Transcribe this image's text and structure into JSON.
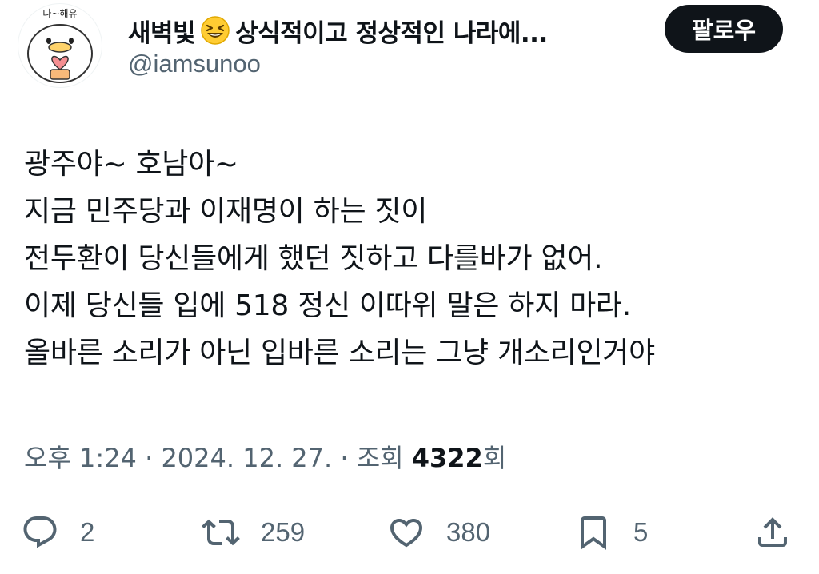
{
  "profile": {
    "display_name": "새벽빛",
    "display_name_suffix": "상식적이고 정상적인 나라에...",
    "emoji": "laughing-face-emoji",
    "handle": "@iamsunoo",
    "avatar_text": "나~해유"
  },
  "follow_button": {
    "label": "팔로우"
  },
  "tweet": {
    "lines": [
      "광주야~ 호남아~",
      "지금 민주당과 이재명이 하는 짓이",
      "전두환이 당신들에게 했던 짓하고 다를바가 없어.",
      "이제 당신들 입에 518 정신 이따위 말은 하지 마라.",
      "올바른 소리가 아닌 입바른 소리는 그냥 개소리인거야"
    ]
  },
  "meta": {
    "time": "오후 1:24",
    "sep1": " · ",
    "date": "2024. 12. 27.",
    "sep2": " · ",
    "views_label": "조회 ",
    "views_count": "4322",
    "views_suffix": "회"
  },
  "actions": {
    "reply": {
      "icon": "reply-icon",
      "count": "2"
    },
    "retweet": {
      "icon": "retweet-icon",
      "count": "259"
    },
    "like": {
      "icon": "heart-icon",
      "count": "380"
    },
    "bookmark": {
      "icon": "bookmark-icon",
      "count": "5"
    },
    "share": {
      "icon": "share-icon"
    }
  },
  "colors": {
    "text": "#0f1419",
    "secondary": "#536471",
    "button_bg": "#0f1419",
    "button_text": "#ffffff",
    "avatar_heart": "#f58f92",
    "emoji_yellow": "#ffcc33"
  }
}
